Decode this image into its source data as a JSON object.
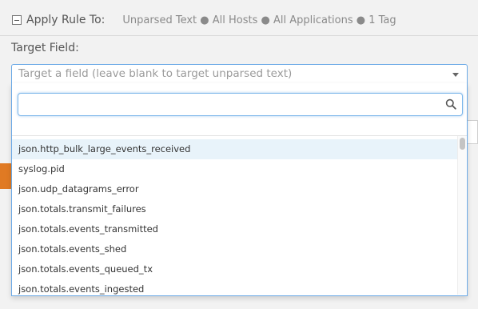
{
  "apply_rule": {
    "label": "Apply Rule To:",
    "summary": "Unparsed Text ● All Hosts ● All Applications ● 1 Tag"
  },
  "target_field": {
    "label": "Target Field:",
    "placeholder": "Target a field (leave blank to target unparsed text)"
  },
  "dropdown": {
    "search_value": "",
    "search_icon": "search-icon",
    "results": [
      "json.http_bulk_large_events_received",
      "syslog.pid",
      "json.udp_datagrams_error",
      "json.totals.transmit_failures",
      "json.totals.events_transmitted",
      "json.totals.events_shed",
      "json.totals.events_queued_tx",
      "json.totals.events_ingested"
    ],
    "highlighted_index": 0
  },
  "colors": {
    "focus_border": "#6aa9e6",
    "highlight_row": "#e8f3fa",
    "accent_button": "#e07a23"
  }
}
